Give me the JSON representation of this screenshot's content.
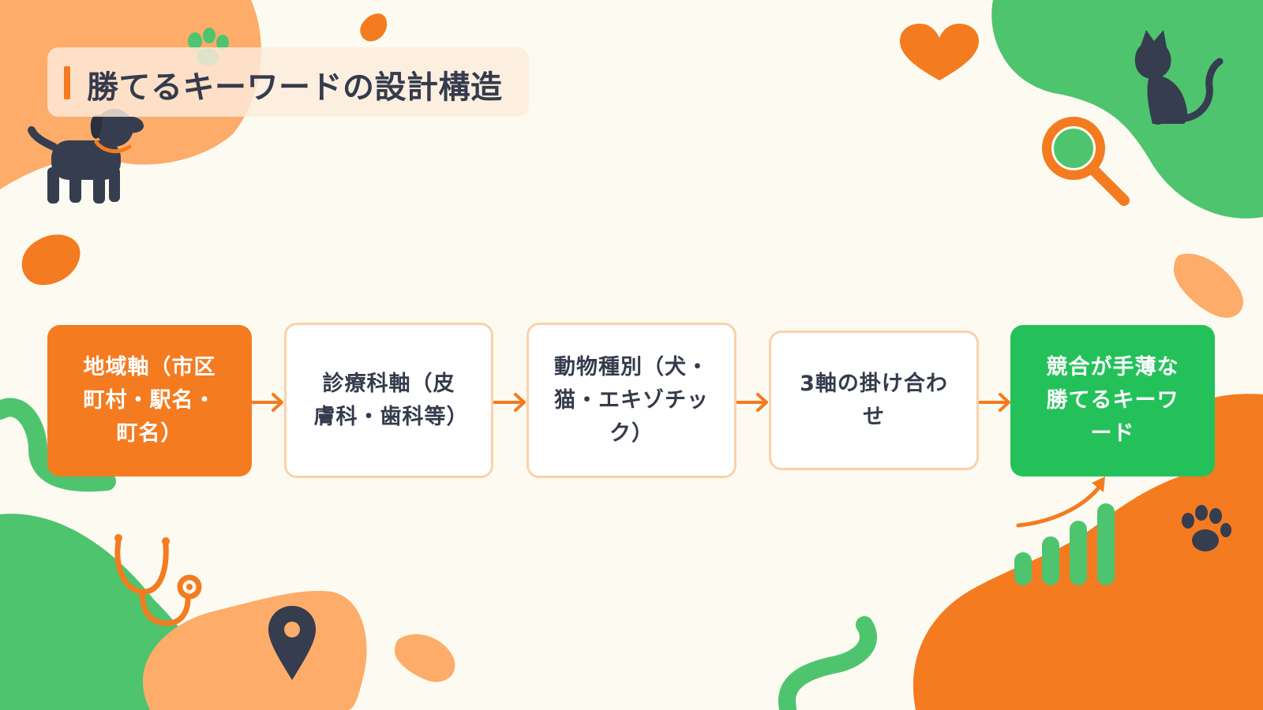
{
  "title": "勝てるキーワードの設計構造",
  "flow": [
    {
      "label": "地域軸（市区町村・駅名・町名）"
    },
    {
      "label": "診療科軸（皮膚科・歯科等）"
    },
    {
      "label": "動物種別（犬・猫・エキゾチック）"
    },
    {
      "label": "3軸の掛け合わせ"
    },
    {
      "label": "競合が手薄な勝てるキーワード"
    }
  ],
  "colors": {
    "accent_orange": "#f47b20",
    "accent_green": "#24c15b",
    "peach": "#fdac6a",
    "text_dark": "#343b4c",
    "box_border": "#fbd1a9",
    "background": "#fdfbf1"
  },
  "icons": [
    "dog-icon",
    "paw-icon",
    "heart-icon",
    "cat-icon",
    "magnifier-icon",
    "stethoscope-icon",
    "location-pin-icon",
    "growth-chart-icon",
    "trend-arrow-icon",
    "arrow-right-icon"
  ]
}
